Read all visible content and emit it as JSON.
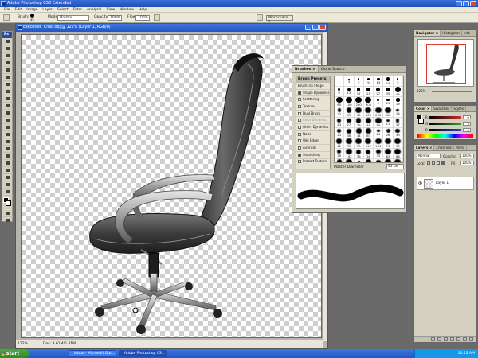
{
  "app": {
    "title": "Adobe Photoshop CS3 Extended"
  },
  "menu": [
    "File",
    "Edit",
    "Image",
    "Layer",
    "Select",
    "Filter",
    "Analysis",
    "View",
    "Window",
    "Help"
  ],
  "options": {
    "brush_label": "Brush:",
    "brush_size": "45",
    "mode_label": "Mode:",
    "mode_value": "Normal",
    "opacity_label": "Opacity:",
    "opacity_value": "100%",
    "flow_label": "Flow:",
    "flow_value": "100%",
    "workspace_label": "Workspace ▾"
  },
  "document": {
    "title": "Executive_Chair.obj @ 122% (Layer 1, RGB/8)",
    "zoom": "122%",
    "status": "Doc: 3.61M/5.31M"
  },
  "brushes_panel": {
    "tabs": [
      "Brushes ×",
      "Clone Source"
    ],
    "section_header": "Brush Presets",
    "options": [
      {
        "label": "Brush Tip Shape",
        "checkbox": false,
        "checked": false,
        "dim": false
      },
      {
        "label": "Shape Dynamics",
        "checkbox": true,
        "checked": true,
        "dim": false
      },
      {
        "label": "Scattering",
        "checkbox": true,
        "checked": false,
        "dim": false
      },
      {
        "label": "Texture",
        "checkbox": true,
        "checked": false,
        "dim": false
      },
      {
        "label": "Dual Brush",
        "checkbox": true,
        "checked": false,
        "dim": false
      },
      {
        "label": "Color Dynamics",
        "checkbox": true,
        "checked": false,
        "dim": true
      },
      {
        "label": "Other Dynamics",
        "checkbox": true,
        "checked": false,
        "dim": false
      },
      {
        "label": "Noise",
        "checkbox": true,
        "checked": false,
        "dim": false
      },
      {
        "label": "Wet Edges",
        "checkbox": true,
        "checked": false,
        "dim": false
      },
      {
        "label": "Airbrush",
        "checkbox": true,
        "checked": false,
        "dim": false
      },
      {
        "label": "Smoothing",
        "checkbox": true,
        "checked": true,
        "dim": false
      },
      {
        "label": "Protect Texture",
        "checkbox": true,
        "checked": false,
        "dim": false
      }
    ],
    "brush_sizes": [
      "1",
      "3",
      "5",
      "9",
      "13",
      "19",
      "5",
      "9",
      "13",
      "17",
      "21",
      "27",
      "35",
      "45",
      "65",
      "100",
      "200",
      "300",
      "9",
      "13",
      "19",
      "17",
      "45",
      "65",
      "100",
      "200",
      "300",
      "14",
      "24",
      "27",
      "39",
      "46",
      "59",
      "11",
      "17",
      "23",
      "36",
      "44",
      "60",
      "14",
      "26",
      "33",
      "42",
      "55",
      "70",
      "112",
      "134",
      "74",
      "95",
      "29",
      "192",
      "36",
      "36",
      "33",
      "63",
      "66",
      "39",
      "63",
      "11",
      "48",
      "32",
      "55",
      "100",
      "75",
      "45"
    ],
    "diameter_label": "Master Diameter",
    "diameter_value": "45 px"
  },
  "navigator_panel": {
    "tabs": [
      "Navigator ×",
      "Histogram",
      "Info"
    ],
    "zoom": "122%"
  },
  "color_panel": {
    "tabs": [
      "Color ×",
      "Swatches",
      "Styles"
    ],
    "channels": [
      {
        "label": "R",
        "value": "0",
        "color": "#d03030"
      },
      {
        "label": "G",
        "value": "0",
        "color": "#30a030"
      },
      {
        "label": "B",
        "value": "0",
        "color": "#3040c8"
      }
    ]
  },
  "layers_panel": {
    "tabs": [
      "Layers ×",
      "Channels",
      "Paths"
    ],
    "blend_mode": "Normal",
    "opacity_label": "Opacity:",
    "opacity_value": "100%",
    "lock_label": "Lock:",
    "fill_label": "Fill:",
    "fill_value": "100%",
    "layer_name": "Layer 1"
  },
  "taskbar": {
    "start_label": "start",
    "tasks": [
      "Inbox - Microsoft Out...",
      "Adobe Photoshop CS..."
    ],
    "clock": "10:42 AM"
  },
  "colors": {
    "accent": "#2057c4",
    "panel_bg": "#d4d0c0"
  }
}
